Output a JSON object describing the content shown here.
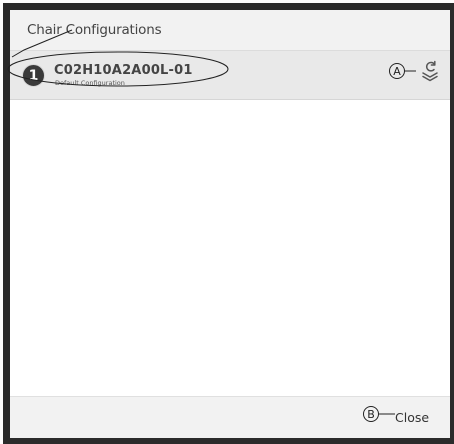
{
  "dialog": {
    "title": "Chair Configurations"
  },
  "configurations": [
    {
      "number": "1",
      "name": "C02H10A2A00L-01",
      "description": "Default Configuration",
      "action_icon": "restore-icon"
    }
  ],
  "footer": {
    "close_label": "Close"
  },
  "callouts": {
    "a": "A",
    "b": "B"
  }
}
